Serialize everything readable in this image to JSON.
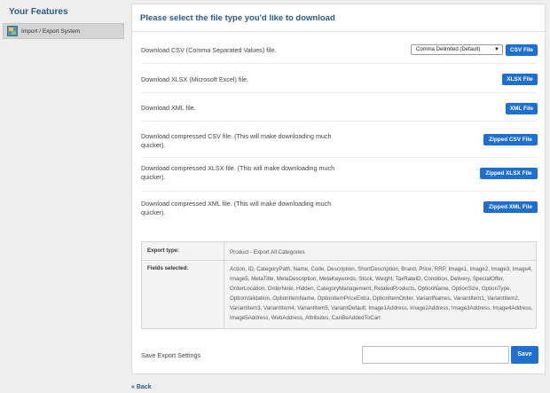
{
  "sidebar": {
    "title": "Your Features",
    "items": [
      {
        "label": "Import / Export System"
      }
    ]
  },
  "main": {
    "title": "Please select the file type you'd like to download",
    "rows": [
      {
        "label": "Download CSV (Comma Separated Values) file.",
        "button": "CSV File"
      },
      {
        "label": "Download XLSX (Microsoft Excel) file.",
        "button": "XLSX File"
      },
      {
        "label": "Download XML file.",
        "button": "XML File"
      },
      {
        "label": "Download compressed CSV file. (This will make downloading much quicker).",
        "button": "Zipped CSV File"
      },
      {
        "label": "Download compressed XLSX file. (This will make downloading much quicker).",
        "button": "Zipped XLSX File"
      },
      {
        "label": "Download compressed XML file. (This will make downloading much quicker).",
        "button": "Zipped XML File"
      }
    ],
    "csv_delimiter": {
      "selected": "Comma Delimited (Default)"
    },
    "summary": {
      "export_type_label": "Export type:",
      "export_type_value": "Product - Export All Categories",
      "fields_label": "Fields selected:",
      "fields_value": "Action, ID, CategoryPath, Name, Code, Description, ShortDescription, Brand, Price, RRP, Image1, Image2, Image3, Image4, Image5, MetaTitle, MetaDescription, MetaKeywords, Stock, Weight, TaxRateID, Condition, Delivery, SpecialOffer, OrderLocation, OrderNote, Hidden, CategoryManagement, RelatedProducts, OptionName, OptionSize, OptionType, OptionValidation, OptionItemName, OptionItemPriceExtra, OptionItemOrder, VariantNames, VariantItem1, VariantItem2, VariantItem3, VariantItem4, VariantItem5, VariantDefault, Image1Address, Image2Address, Image3Address, Image4Address, Image5Address, WebAddress, Attributes, CanBeAddedToCart"
    },
    "save": {
      "label": "Save Export Settings",
      "input_value": "",
      "button": "Save"
    },
    "back_link": "« Back"
  },
  "colors": {
    "accent": "#1e6fd0",
    "title": "#2a5a8c"
  },
  "icons": {
    "sidebar_item": "import-export-icon",
    "select_arrow": "triangle-down-icon"
  }
}
